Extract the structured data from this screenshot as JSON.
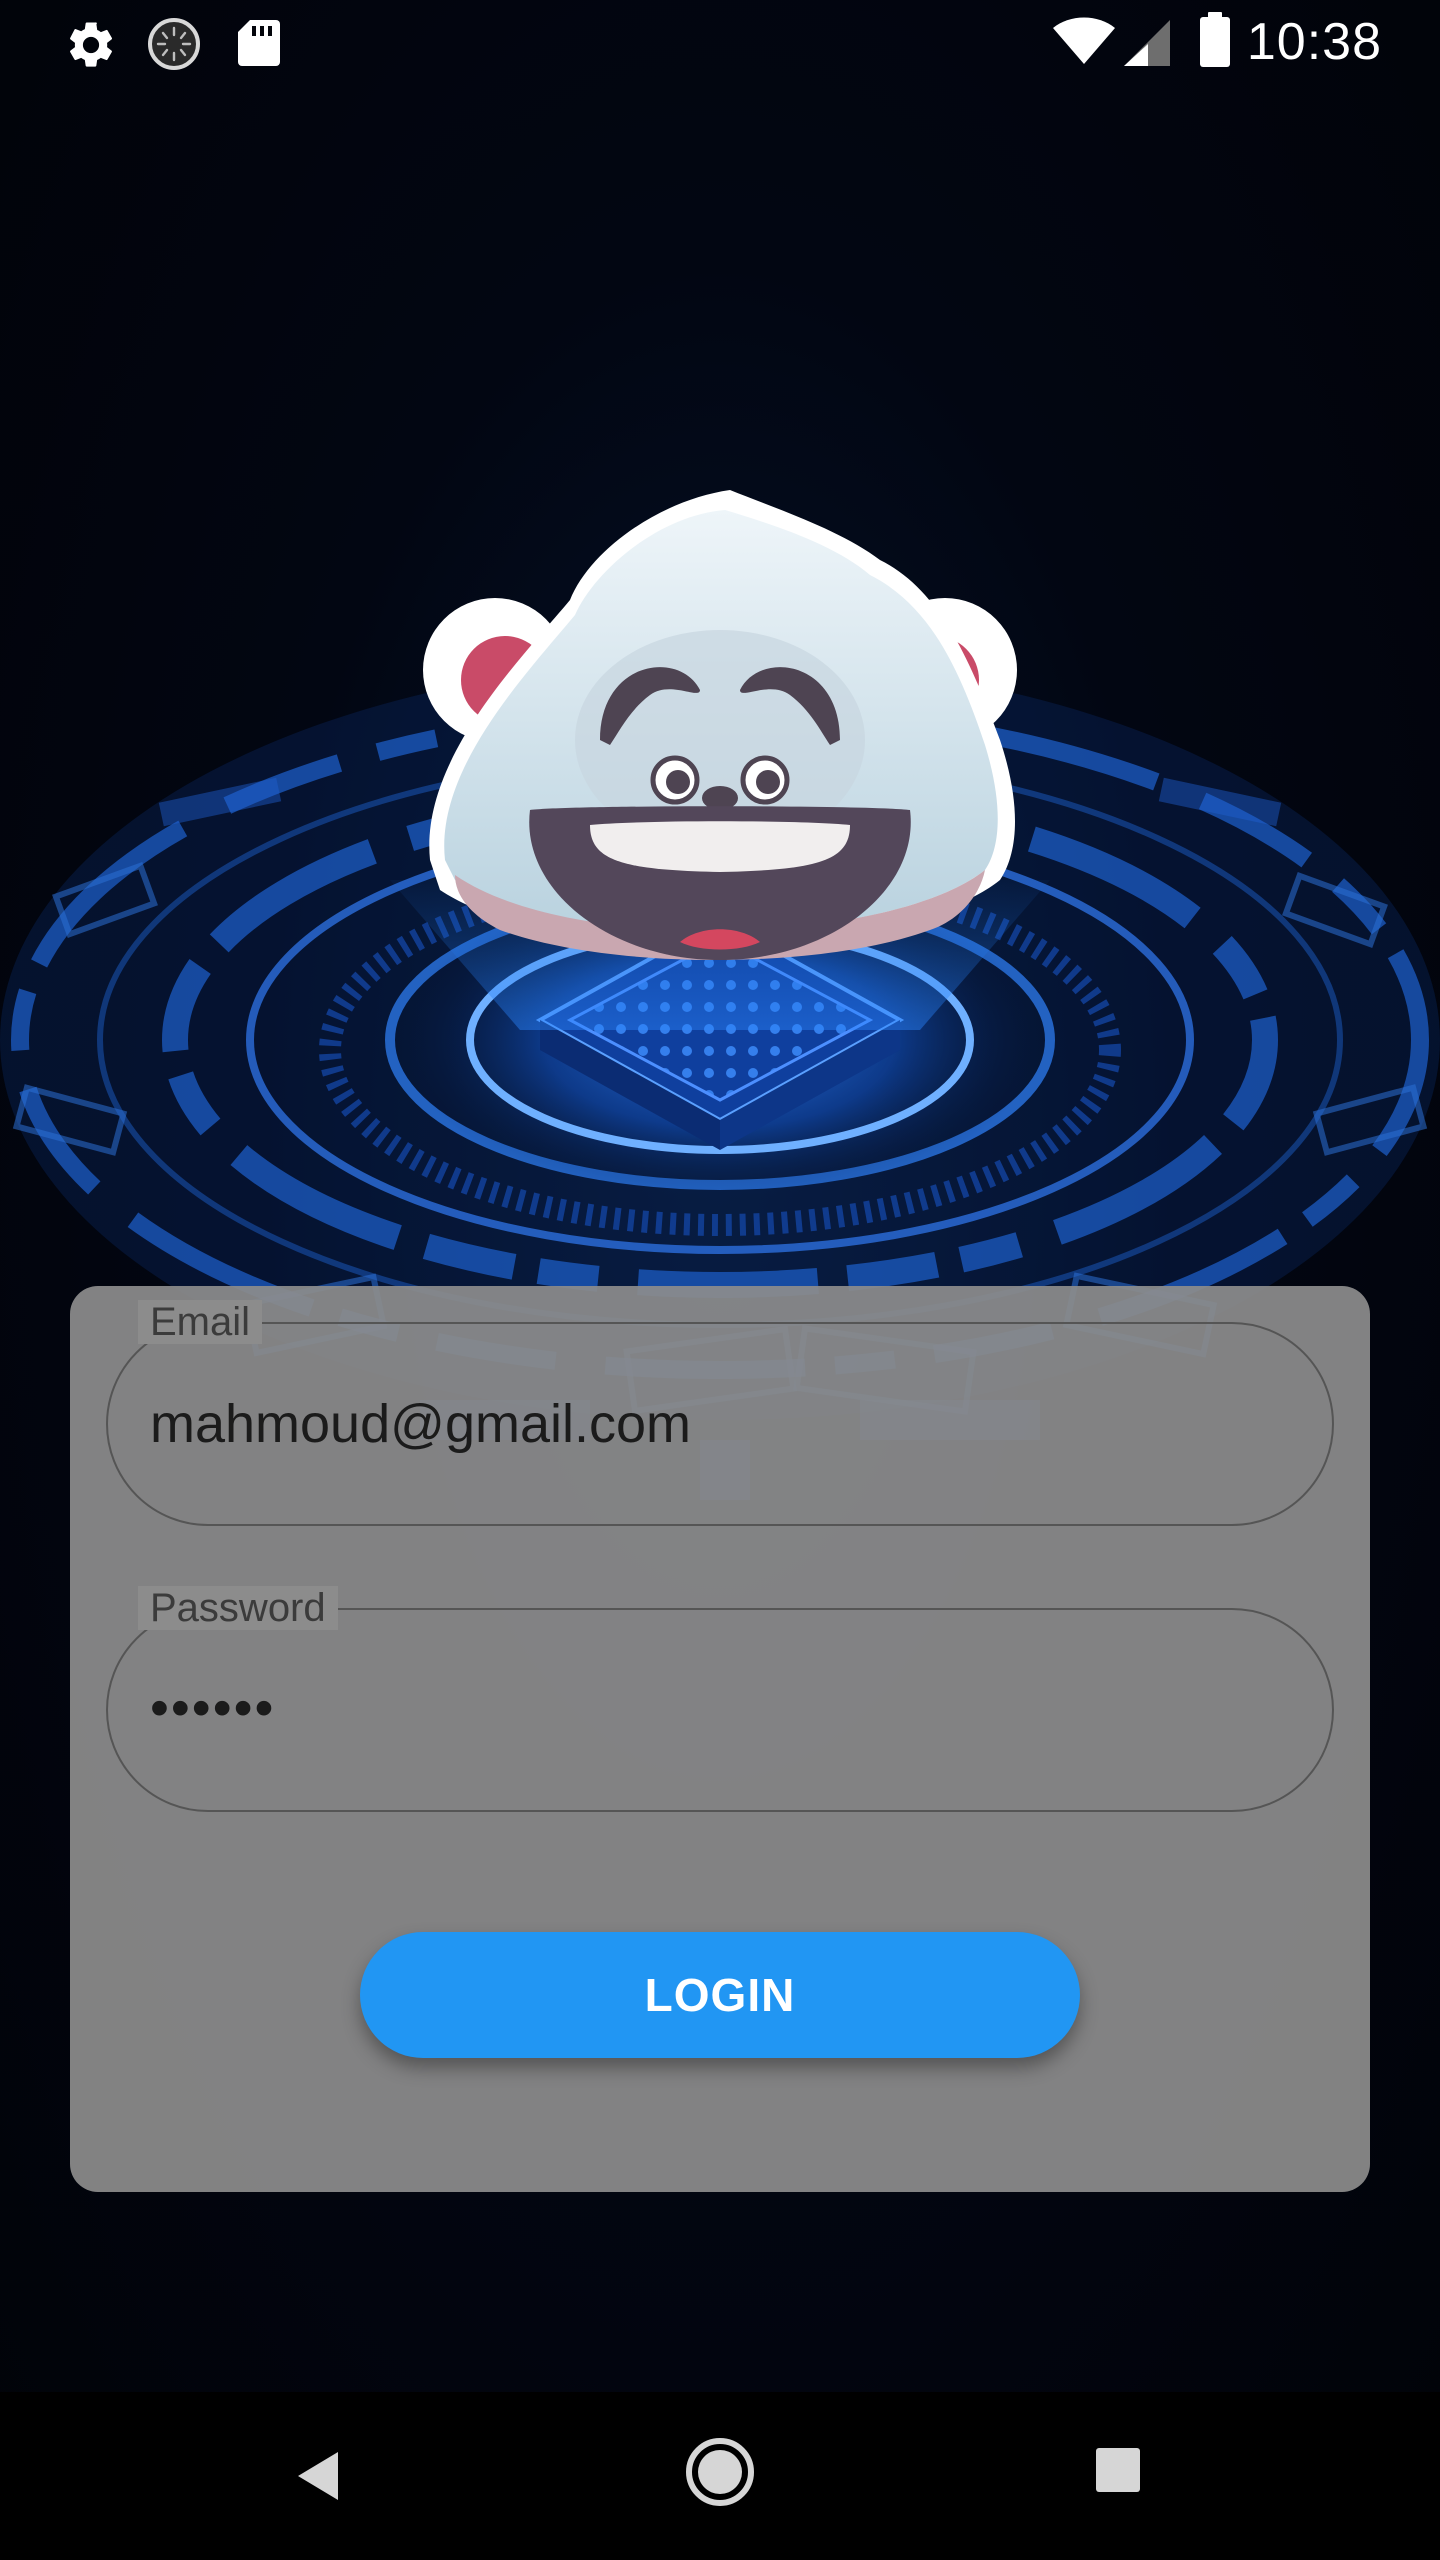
{
  "status_bar": {
    "time": "10:38",
    "left_icons": [
      "settings-icon",
      "sync-icon",
      "sd-card-icon"
    ],
    "right_icons": [
      "wifi-icon",
      "cell-signal-icon",
      "battery-icon"
    ]
  },
  "hero": {
    "mascot": "polar-bear-mascot",
    "background": "circuit-hologram"
  },
  "login_form": {
    "email": {
      "label": "Email",
      "value": "mahmoud@gmail.com"
    },
    "password": {
      "label": "Password",
      "value": "••••••"
    },
    "login_button": "LOGIN"
  },
  "nav_bar": {
    "buttons": [
      "back-icon",
      "home-icon",
      "recents-icon"
    ]
  },
  "colors": {
    "accent": "#2196f3",
    "card": "#8c8c8c",
    "background": "#03050b",
    "hologram": "#1f78ff"
  }
}
